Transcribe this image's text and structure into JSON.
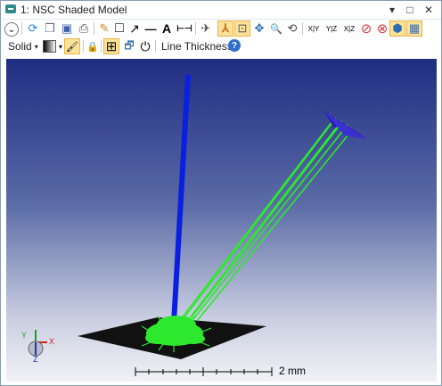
{
  "window": {
    "title": "1: NSC Shaded Model"
  },
  "title_controls": [
    "▾",
    "□",
    "✕"
  ],
  "toolbar2": {
    "render_mode": "Solid",
    "line_thickness": "Line Thickness"
  },
  "toolbar_icons_row1": [
    {
      "name": "collapse-toolbar-icon",
      "glyph": "⌄"
    },
    {
      "name": "refresh-icon",
      "glyph": "⟳",
      "color": "#1e88e5"
    },
    {
      "name": "copy-icon",
      "glyph": "❐",
      "color": "#5a6a85"
    },
    {
      "name": "save-icon",
      "glyph": "▣",
      "color": "#3a5ea8"
    },
    {
      "name": "print-icon",
      "glyph": "⎙",
      "color": "#444"
    },
    {
      "name": "pencil-icon",
      "glyph": "✎",
      "color": "#c8861a"
    },
    {
      "name": "rectangle-icon",
      "glyph": "□",
      "color": "#000"
    },
    {
      "name": "arrow-icon",
      "glyph": "↗",
      "color": "#000"
    },
    {
      "name": "line-icon",
      "glyph": "—",
      "color": "#000"
    },
    {
      "name": "text-icon",
      "glyph": "A",
      "color": "#000"
    },
    {
      "name": "dimension-icon",
      "glyph": "⊢⊣",
      "color": "#000"
    },
    {
      "name": "rotate-view-icon",
      "glyph": "✈",
      "color": "#444"
    },
    {
      "name": "axes-icon",
      "glyph": "⅄",
      "color": "#c86a10"
    },
    {
      "name": "zoom-window-icon",
      "glyph": "⊡",
      "color": "#555"
    },
    {
      "name": "pan-icon",
      "glyph": "✥",
      "color": "#2a6db0"
    },
    {
      "name": "zoom-icon",
      "glyph": "🔍",
      "color": "#444"
    },
    {
      "name": "reset-view-icon",
      "glyph": "⟲",
      "color": "#444"
    },
    {
      "name": "xy-view-icon",
      "glyph": "X|Y",
      "color": "#333"
    },
    {
      "name": "yz-view-icon",
      "glyph": "Y|Z",
      "color": "#333"
    },
    {
      "name": "xz-view-icon",
      "glyph": "X|Z",
      "color": "#333"
    },
    {
      "name": "rotate-x-icon",
      "glyph": "⊘",
      "color": "#d23c3c"
    },
    {
      "name": "stop-icon",
      "glyph": "⊗",
      "color": "#d23c3c"
    },
    {
      "name": "3d-box-icon",
      "glyph": "⬢",
      "color": "#2a6db0"
    },
    {
      "name": "layers-icon",
      "glyph": "▦",
      "color": "#3a6ea8"
    }
  ],
  "toolbar_icons_row2": [
    {
      "name": "color-gradient-icon",
      "glyph": "▮"
    },
    {
      "name": "brush-icon",
      "glyph": "🖌"
    },
    {
      "name": "lock-icon",
      "glyph": "🔒"
    },
    {
      "name": "grid-icon",
      "glyph": "⊞"
    },
    {
      "name": "window-icon",
      "glyph": "🗗"
    },
    {
      "name": "power-icon",
      "glyph": "⏻"
    },
    {
      "name": "help-icon",
      "glyph": "?"
    }
  ],
  "scale": {
    "label": "2 mm"
  },
  "colors": {
    "background_top": "#1f2d82",
    "background_bottom": "#f2f2f6",
    "source_beam": "#0b1fe0",
    "rays": "#2ee82e",
    "detector": "#2a1fb0",
    "plate": "#111111"
  }
}
